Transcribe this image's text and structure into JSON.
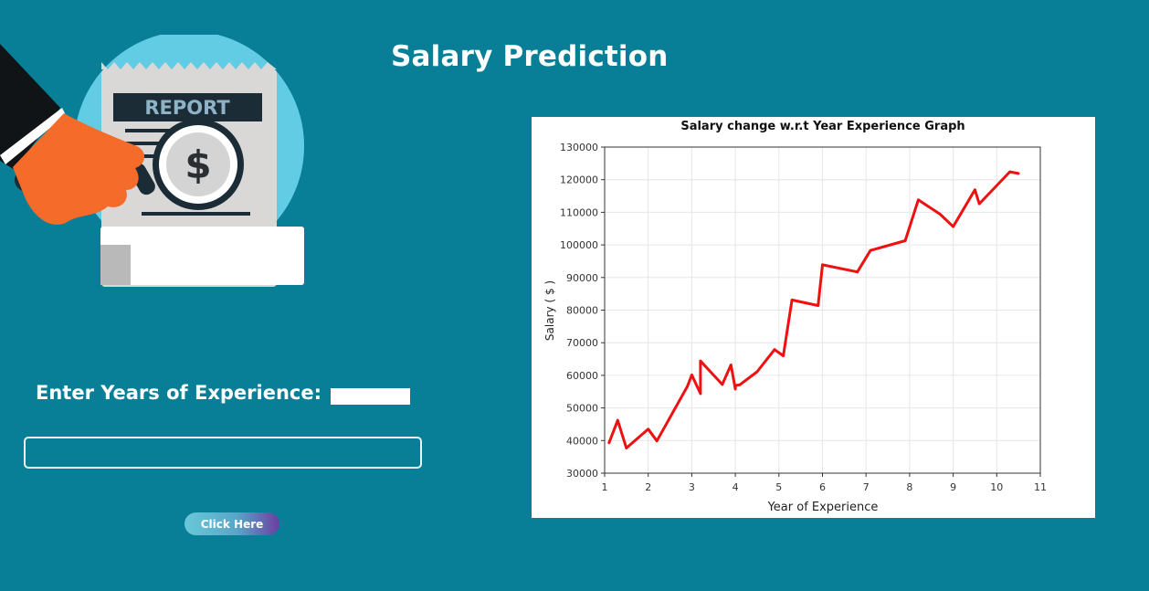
{
  "page": {
    "title": "Salary Prediction"
  },
  "form": {
    "label": "Enter Years of Experience:",
    "input_value": "",
    "input_placeholder": "",
    "button_label": "Click Here"
  },
  "illustration": {
    "icon": "report-magnifier-illustration",
    "report_text": "REPORT",
    "currency_symbol": "$"
  },
  "colors": {
    "background": "#087f97",
    "line": "#ee1111",
    "circle": "#62cce4",
    "hand": "#f46b2a"
  },
  "chart_data": {
    "type": "line",
    "title": "Salary change w.r.t Year Experience Graph",
    "xlabel": "Year of Experience",
    "ylabel": "Salary ( $ )",
    "xlim": [
      1,
      11
    ],
    "ylim": [
      30000,
      130000
    ],
    "xticks": [
      "1",
      "2",
      "3",
      "4",
      "5",
      "6",
      "7",
      "8",
      "9",
      "10",
      "11"
    ],
    "yticks": [
      "30000",
      "40000",
      "50000",
      "60000",
      "70000",
      "80000",
      "90000",
      "100000",
      "110000",
      "120000",
      "130000"
    ],
    "grid": true,
    "series": [
      {
        "values": [
          {
            "x": 1.1,
            "y": 39300
          },
          {
            "x": 1.3,
            "y": 46200
          },
          {
            "x": 1.5,
            "y": 37700
          },
          {
            "x": 2.0,
            "y": 43500
          },
          {
            "x": 2.2,
            "y": 39900
          },
          {
            "x": 2.9,
            "y": 56600
          },
          {
            "x": 3.0,
            "y": 60100
          },
          {
            "x": 3.2,
            "y": 54400
          },
          {
            "x": 3.2,
            "y": 64400
          },
          {
            "x": 3.7,
            "y": 57200
          },
          {
            "x": 3.9,
            "y": 63200
          },
          {
            "x": 4.0,
            "y": 55800
          },
          {
            "x": 4.0,
            "y": 56900
          },
          {
            "x": 4.1,
            "y": 57100
          },
          {
            "x": 4.5,
            "y": 61100
          },
          {
            "x": 4.9,
            "y": 67900
          },
          {
            "x": 5.1,
            "y": 66000
          },
          {
            "x": 5.3,
            "y": 83100
          },
          {
            "x": 5.9,
            "y": 81400
          },
          {
            "x": 6.0,
            "y": 93900
          },
          {
            "x": 6.8,
            "y": 91700
          },
          {
            "x": 7.1,
            "y": 98300
          },
          {
            "x": 7.9,
            "y": 101300
          },
          {
            "x": 8.2,
            "y": 113800
          },
          {
            "x": 8.7,
            "y": 109400
          },
          {
            "x": 9.0,
            "y": 105600
          },
          {
            "x": 9.5,
            "y": 116900
          },
          {
            "x": 9.6,
            "y": 112600
          },
          {
            "x": 10.3,
            "y": 122400
          },
          {
            "x": 10.5,
            "y": 121900
          }
        ]
      }
    ]
  }
}
